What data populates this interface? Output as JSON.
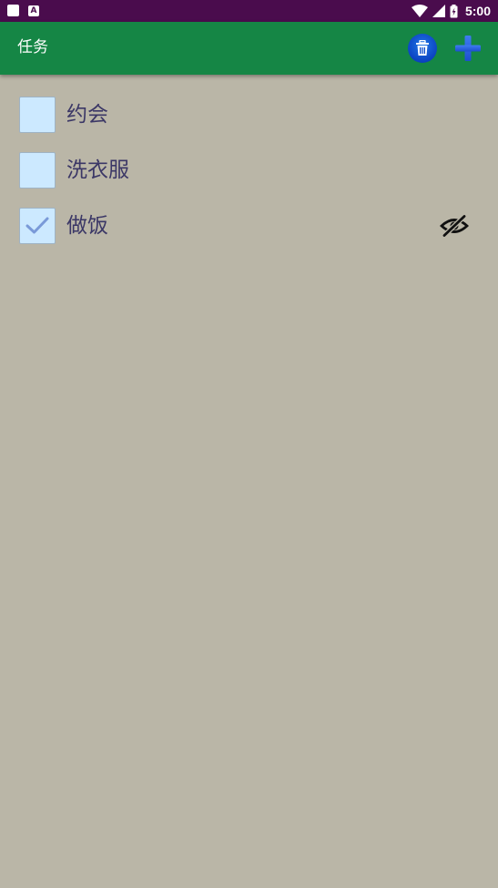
{
  "status_bar": {
    "time": "5:00",
    "left_icons": [
      "notification-square-icon",
      "a-letter-icon"
    ],
    "right_icons": [
      "wifi-icon",
      "signal-icon",
      "battery-icon"
    ]
  },
  "app_bar": {
    "title": "任务",
    "actions": [
      "trash-icon",
      "plus-icon"
    ]
  },
  "tasks": [
    {
      "label": "约会",
      "checked": false,
      "hidden_indicator": false
    },
    {
      "label": "洗衣服",
      "checked": false,
      "hidden_indicator": false
    },
    {
      "label": "做饭",
      "checked": true,
      "hidden_indicator": true
    }
  ],
  "colors": {
    "status_bar": "#4a0c4d",
    "app_bar": "#158645",
    "background": "#bab6a7",
    "checkbox_fill": "#cce9ff",
    "task_text": "#3b3766",
    "accent_blue": "#1f5fd6"
  }
}
